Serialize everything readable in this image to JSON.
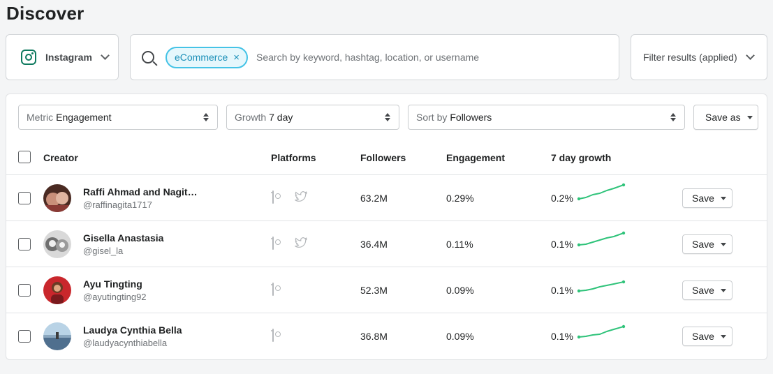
{
  "page": {
    "title": "Discover"
  },
  "platform_select": {
    "value": "Instagram",
    "icon": "instagram-icon"
  },
  "search": {
    "chip": "eCommerce",
    "chip_remove": "×",
    "placeholder": "Search by keyword, hashtag, location, or username",
    "value": ""
  },
  "filter": {
    "label": "Filter results (applied)"
  },
  "toolbar": {
    "metric": {
      "prefix": "Metric",
      "value": "Engagement"
    },
    "growth": {
      "prefix": "Growth",
      "value": "7 day"
    },
    "sort": {
      "prefix": "Sort by",
      "value": "Followers"
    },
    "save_as": "Save as"
  },
  "columns": {
    "creator": "Creator",
    "platforms": "Platforms",
    "followers": "Followers",
    "engagement": "Engagement",
    "growth": "7 day growth"
  },
  "rows": [
    {
      "name": "Raffi Ahmad and Nagit…",
      "handle": "@raffinagita1717",
      "platforms": [
        "instagram",
        "twitter"
      ],
      "followers": "63.2M",
      "engagement": "0.29%",
      "growth": "0.2%",
      "save": "Save"
    },
    {
      "name": "Gisella Anastasia",
      "handle": "@gisel_la",
      "platforms": [
        "instagram",
        "twitter"
      ],
      "followers": "36.4M",
      "engagement": "0.11%",
      "growth": "0.1%",
      "save": "Save"
    },
    {
      "name": "Ayu Tingting",
      "handle": "@ayutingting92",
      "platforms": [
        "instagram"
      ],
      "followers": "52.3M",
      "engagement": "0.09%",
      "growth": "0.1%",
      "save": "Save"
    },
    {
      "name": "Laudya Cynthia Bella",
      "handle": "@laudyacynthiabella",
      "platforms": [
        "instagram"
      ],
      "followers": "36.8M",
      "engagement": "0.09%",
      "growth": "0.1%",
      "save": "Save"
    }
  ],
  "colors": {
    "accent_green": "#2fc37a",
    "chip_border": "#45c3e6",
    "chip_bg": "#e6f7fc"
  }
}
